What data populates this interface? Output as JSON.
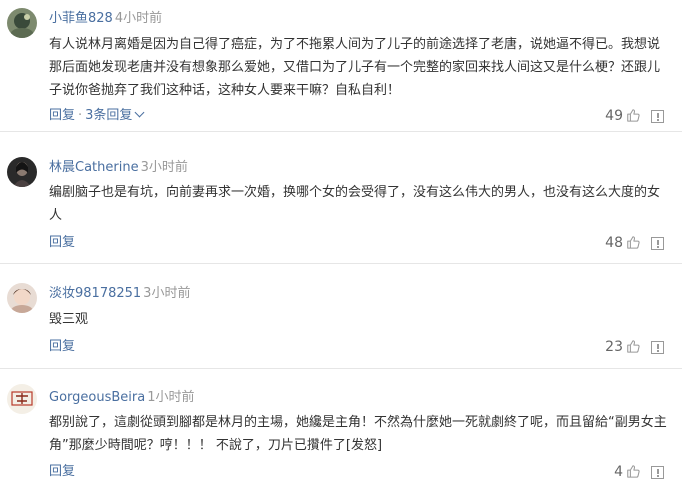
{
  "comments": [
    {
      "username": "小菲鱼828",
      "time": "4小时前",
      "text": "有人说林月离婚是因为自己得了癌症，为了不拖累人间为了儿子的前途选择了老唐，说她逼不得已。我想说那后面她发现老唐并没有想象那么爱她，又借口为了儿子有一个完整的家回来找人间这又是什么梗？还跟儿子说你爸抛弃了我们这种话，这种女人要来干嘛？自私自利！",
      "reply_label": "回复",
      "separator": "·",
      "replies_label": "3条回复",
      "likes": "49"
    },
    {
      "username": "林晨Catherine",
      "time": "3小时前",
      "text": "编剧脑子也是有坑，向前妻再求一次婚，换哪个女的会受得了，没有这么伟大的男人，也没有这么大度的女人",
      "reply_label": "回复",
      "likes": "48"
    },
    {
      "username": "淡妆98178251",
      "time": "3小时前",
      "text": "毁三观",
      "reply_label": "回复",
      "likes": "23"
    },
    {
      "username": "GorgeousBeira",
      "time": "1小时前",
      "text": "都别說了，這劇從頭到腳都是林月的主場，她纔是主角！不然為什麼她一死就劇終了呢，而且留給“副男女主角”那麼少時間呢？哼！！！ 不說了，刀片已攢件了[发怒]",
      "reply_label": "回复",
      "likes": "4"
    }
  ],
  "colors": {
    "username": "#4a6fa0",
    "time": "#999999",
    "text": "#333333",
    "divider": "#e6e6e6"
  },
  "icons": {
    "like": "thumbs-up-icon",
    "report": "report-icon",
    "expand": "chevron-down-icon"
  }
}
